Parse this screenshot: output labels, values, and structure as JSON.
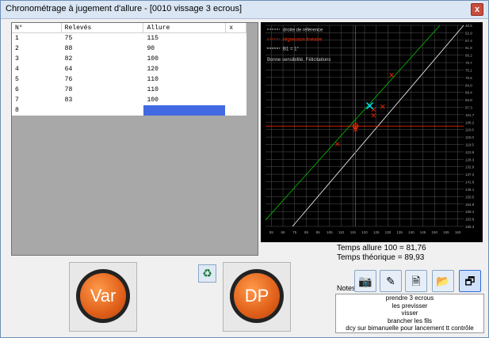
{
  "window": {
    "title": "Chronométrage à jugement d'allure - [0010 vissage 3 ecrous]",
    "close_glyph": "x"
  },
  "table": {
    "headers": [
      "N°",
      "Relevés",
      "Allure",
      "x"
    ],
    "rows": [
      [
        "1",
        "75",
        "115",
        ""
      ],
      [
        "2",
        "88",
        "90",
        ""
      ],
      [
        "3",
        "82",
        "100",
        ""
      ],
      [
        "4",
        "64",
        "120",
        ""
      ],
      [
        "5",
        "76",
        "110",
        ""
      ],
      [
        "6",
        "78",
        "110",
        ""
      ],
      [
        "7",
        "83",
        "100",
        ""
      ],
      [
        "8",
        "",
        "",
        ""
      ]
    ]
  },
  "chart_data": {
    "type": "scatter",
    "legend": [
      "droite de référence",
      "régression linéaire",
      "B1 = 1°"
    ],
    "message": "Bonne sensibilité, Félicitations",
    "x_ticks": [
      "55",
      "65",
      "75",
      "85",
      "95",
      "105",
      "110",
      "115",
      "120",
      "125",
      "130",
      "135",
      "140",
      "145",
      "150",
      "155",
      "160"
    ],
    "y_ticks": [
      "48.5",
      "52.9",
      "57.4",
      "61.8",
      "66.2",
      "70.7",
      "75.1",
      "79.6",
      "84.0",
      "88.4",
      "92.8",
      "97.3",
      "101.7",
      "106.2",
      "110.6",
      "115.0",
      "119.5",
      "123.9",
      "128.3",
      "132.8",
      "137.2",
      "141.6",
      "146.1",
      "150.5",
      "154.9",
      "159.4",
      "163.8",
      "168.3"
    ],
    "points": [
      {
        "x": 115,
        "y": 75
      },
      {
        "x": 90,
        "y": 88
      },
      {
        "x": 100,
        "y": 82
      },
      {
        "x": 120,
        "y": 64
      },
      {
        "x": 110,
        "y": 76
      },
      {
        "x": 110,
        "y": 78
      },
      {
        "x": 100,
        "y": 83
      }
    ],
    "mean_point": {
      "x": 107.86,
      "y": 78.0
    },
    "theoretical_point": {
      "x": 100,
      "y": 81.76
    },
    "colors": {
      "background": "#000000",
      "reference": "#ffffff",
      "regression": "#00cc00",
      "crosshair": "#ff2a00",
      "points": "#ff2a00",
      "mean": "#00e5ff"
    }
  },
  "results": {
    "t_allure": "Temps allure 100 = 81,76",
    "t_theorique": "Temps théorique = 89,93"
  },
  "buttons": {
    "var": "Var",
    "dp": "DP"
  },
  "notes": {
    "label": "Notes",
    "lines": [
      "prendre 3 ecrous",
      "les previsser",
      "visser",
      "brancher les fils",
      "dcy sur bimanuelle pour lancement tt contrôle"
    ]
  },
  "icons": {
    "recycle": "recycle-icon",
    "camera": "camera-icon",
    "edit": "edit-icon",
    "document": "document-icon",
    "folder": "folder-icon",
    "gallery": "gallery-icon"
  }
}
